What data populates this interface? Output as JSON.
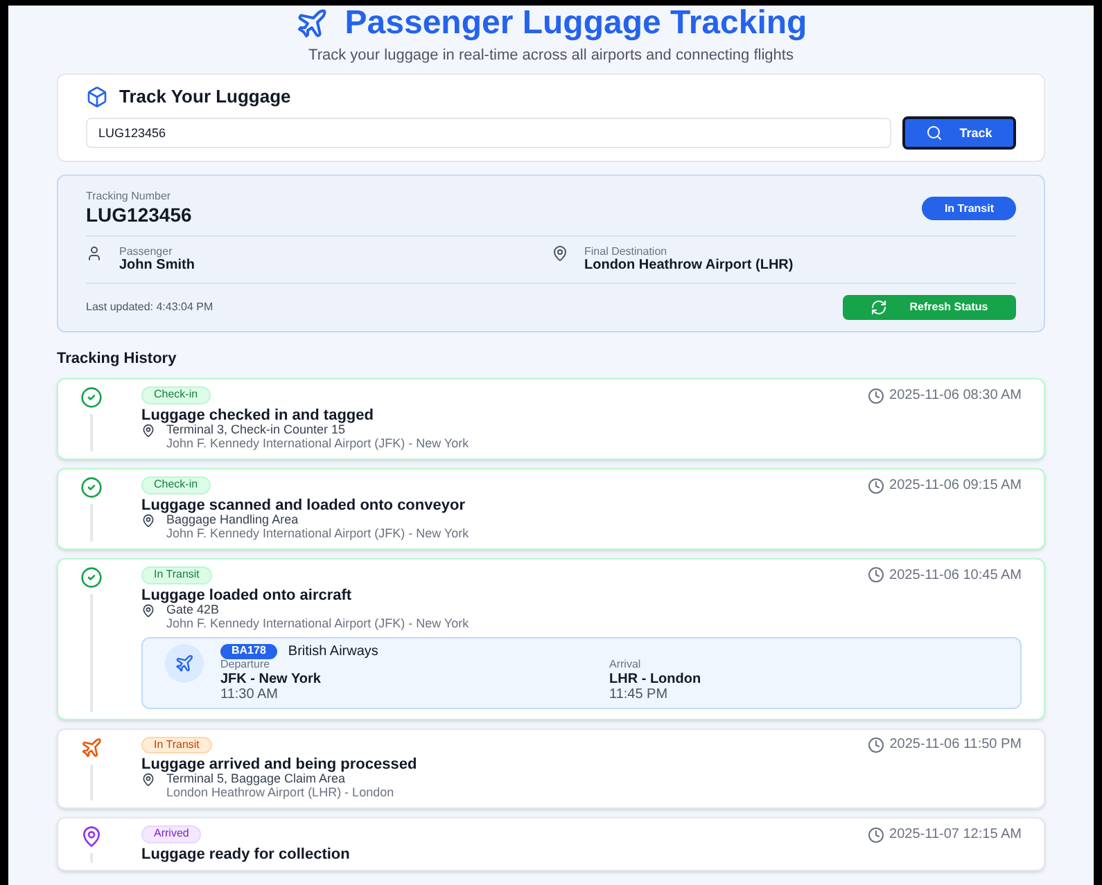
{
  "header": {
    "title": "Passenger Luggage Tracking",
    "subtitle": "Track your luggage in real-time across all airports and connecting flights"
  },
  "search": {
    "title": "Track Your Luggage",
    "value": "LUG123456",
    "button": "Track"
  },
  "summary": {
    "tracking_label": "Tracking Number",
    "tracking_number": "LUG123456",
    "status": "In Transit",
    "passenger_label": "Passenger",
    "passenger": "John Smith",
    "destination_label": "Final Destination",
    "destination": "London Heathrow Airport (LHR)",
    "last_updated": "Last updated: 4:43:04 PM",
    "refresh_button": "Refresh Status"
  },
  "history": {
    "title": "Tracking History",
    "events": [
      {
        "kind": "done",
        "badge": "Check-in",
        "time": "2025-11-06 08:30 AM",
        "title": "Luggage checked in and tagged",
        "location": "Terminal 3, Check-in Counter 15",
        "airport": "John F. Kennedy International Airport (JFK) - New York"
      },
      {
        "kind": "done",
        "badge": "Check-in",
        "time": "2025-11-06 09:15 AM",
        "title": "Luggage scanned and loaded onto conveyor",
        "location": "Baggage Handling Area",
        "airport": "John F. Kennedy International Airport (JFK) - New York"
      },
      {
        "kind": "done",
        "badge": "In Transit",
        "time": "2025-11-06 10:45 AM",
        "title": "Luggage loaded onto aircraft",
        "location": "Gate 42B",
        "airport": "John F. Kennedy International Airport (JFK) - New York",
        "flight": {
          "number": "BA178",
          "airline": "British Airways",
          "departure_label": "Departure",
          "departure": "JFK - New York",
          "departure_time": "11:30 AM",
          "arrival_label": "Arrival",
          "arrival": "LHR - London",
          "arrival_time": "11:45 PM"
        }
      },
      {
        "kind": "transit",
        "badge": "In Transit",
        "time": "2025-11-06 11:50 PM",
        "title": "Luggage arrived and being processed",
        "location": "Terminal 5, Baggage Claim Area",
        "airport": "London Heathrow Airport (LHR) - London"
      },
      {
        "kind": "arrived",
        "badge": "Arrived",
        "time": "2025-11-07 12:15 AM",
        "title": "Luggage ready for collection"
      }
    ]
  }
}
